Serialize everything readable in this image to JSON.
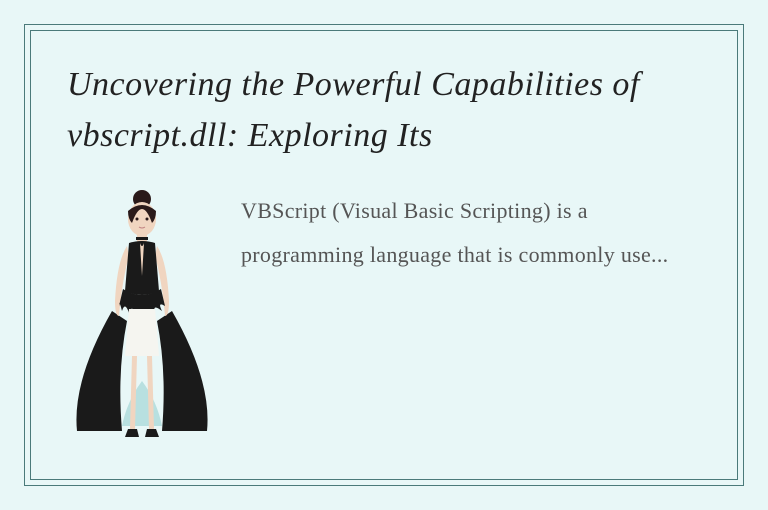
{
  "card": {
    "title": "Uncovering the Powerful Capabilities of vbscript.dll: Exploring Its",
    "body": "VBScript (Visual Basic Scripting) is a programming language that is commonly use...",
    "image_alt": "character-illustration"
  }
}
